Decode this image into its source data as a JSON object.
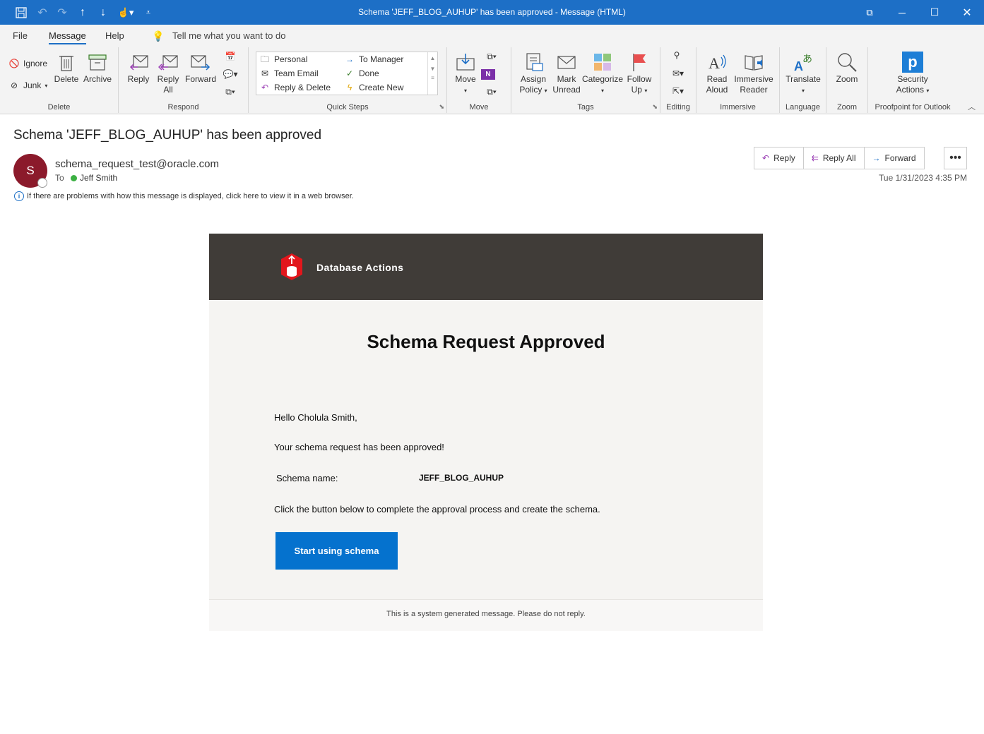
{
  "window": {
    "title": "Schema 'JEFF_BLOG_AUHUP' has been approved  -  Message (HTML)"
  },
  "menu": {
    "tabs": [
      "File",
      "Message",
      "Help"
    ],
    "active_tab": "Message",
    "tell_me": "Tell me what you want to do"
  },
  "ribbon": {
    "delete_group": {
      "label": "Delete",
      "ignore": "Ignore",
      "junk": "Junk",
      "delete": "Delete",
      "archive": "Archive"
    },
    "respond_group": {
      "label": "Respond",
      "reply": "Reply",
      "reply_all_1": "Reply",
      "reply_all_2": "All",
      "forward": "Forward"
    },
    "quick_steps": {
      "label": "Quick Steps",
      "items": [
        "Personal",
        "Team Email",
        "Reply & Delete",
        "To Manager",
        "Done",
        "Create New"
      ]
    },
    "move_group": {
      "label": "Move",
      "move": "Move"
    },
    "tags_group": {
      "label": "Tags",
      "assign_1": "Assign",
      "assign_2": "Policy",
      "mark_1": "Mark",
      "mark_2": "Unread",
      "categorize": "Categorize",
      "follow_1": "Follow",
      "follow_2": "Up"
    },
    "editing_group": {
      "label": "Editing"
    },
    "immersive_group": {
      "label": "Immersive",
      "read_1": "Read",
      "read_2": "Aloud",
      "imm_1": "Immersive",
      "imm_2": "Reader"
    },
    "language_group": {
      "label": "Language",
      "translate": "Translate"
    },
    "zoom_group": {
      "label": "Zoom",
      "zoom": "Zoom"
    },
    "proofpoint_group": {
      "label": "Proofpoint for Outlook",
      "sec_1": "Security",
      "sec_2": "Actions"
    }
  },
  "message": {
    "subject": "Schema 'JEFF_BLOG_AUHUP' has been approved",
    "avatar_letter": "S",
    "from": "schema_request_test@oracle.com",
    "to_label": "To",
    "to": "Jeff Smith",
    "info_bar": "If there are problems with how this message is displayed, click here to view it in a web browser.",
    "actions": {
      "reply": "Reply",
      "reply_all": "Reply All",
      "forward": "Forward",
      "more": "•••"
    },
    "date": "Tue 1/31/2023 4:35 PM"
  },
  "email": {
    "brand": "Database Actions",
    "heading": "Schema Request Approved",
    "greeting": "Hello Cholula Smith,",
    "approved_text": "Your schema request has been approved!",
    "schema_label": "Schema name:",
    "schema_value": "JEFF_BLOG_AUHUP",
    "instructions": "Click the button below to complete the approval process and create the schema.",
    "button": "Start using schema",
    "footer": "This is a system generated message. Please do not reply.",
    "colors": {
      "header": "#403c38",
      "button": "#0572ce",
      "brand_red": "#e2161c"
    }
  },
  "colors": {
    "titlebar": "#1d6fc6",
    "avatar": "#8b1a2b"
  }
}
